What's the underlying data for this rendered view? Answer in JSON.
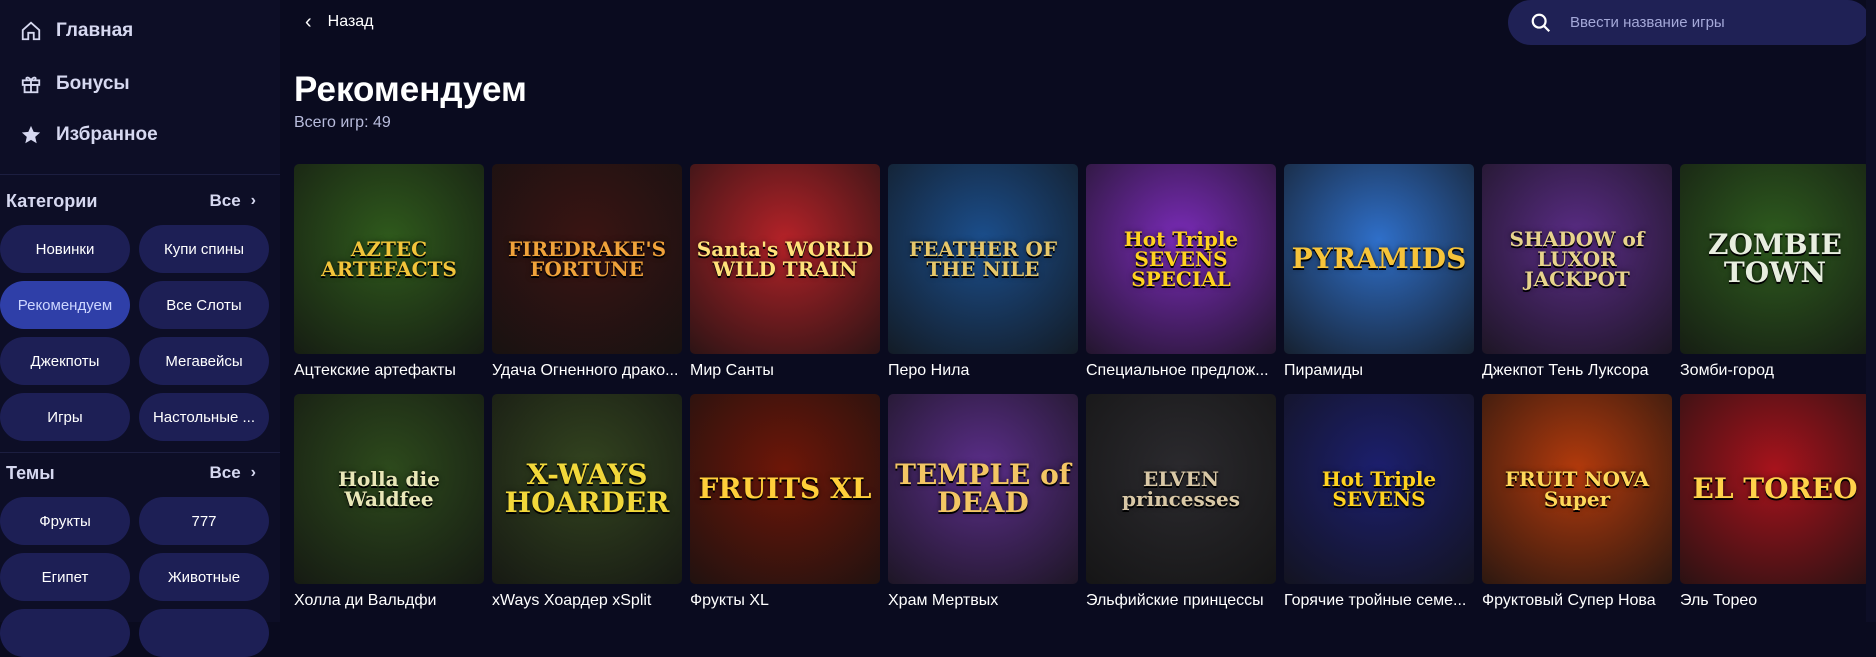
{
  "sidebar": {
    "nav": [
      {
        "label": "Главная",
        "icon": "home-icon"
      },
      {
        "label": "Бонусы",
        "icon": "gift-icon"
      },
      {
        "label": "Избранное",
        "icon": "star-icon"
      }
    ],
    "categories": {
      "title": "Категории",
      "all_label": "Все",
      "items": [
        "Новинки",
        "Купи спины",
        "Рекомендуем",
        "Все Слоты",
        "Джекпоты",
        "Мегавейсы",
        "Игры",
        "Настольные ..."
      ],
      "active": "Рекомендуем"
    },
    "themes": {
      "title": "Темы",
      "all_label": "Все",
      "items": [
        "Фрукты",
        "777",
        "Египет",
        "Животные"
      ]
    }
  },
  "topbar": {
    "back_label": "Назад",
    "search_placeholder": "Ввести название игры"
  },
  "main": {
    "title": "Рекомендуем",
    "count": "Всего игр: 49",
    "games": [
      {
        "name": "Ацтекские артефакты",
        "logo": "AZTEC ARTEFACTS",
        "bg": "#2f5a1c",
        "fg": "#f2c43a"
      },
      {
        "name": "Удача Огненного драко...",
        "logo": "FIREDRAKE'S FORTUNE",
        "bg": "#3a1412",
        "fg": "#f0a23a"
      },
      {
        "name": "Мир Санты",
        "logo": "Santa's WORLD WILD TRAIN",
        "bg": "#b42228",
        "fg": "#ffe27a"
      },
      {
        "name": "Перо Нила",
        "logo": "FEATHER OF THE NILE",
        "bg": "#1b4e8c",
        "fg": "#e6c76a"
      },
      {
        "name": "Специальное предлож...",
        "logo": "Hot Triple SEVENS SPECIAL",
        "bg": "#7a2bb8",
        "fg": "#ffd21f"
      },
      {
        "name": "Пирамиды",
        "logo": "PYRAMIDS",
        "bg": "#2f6fc9",
        "fg": "#f7c43a"
      },
      {
        "name": "Джекпот Тень Луксора",
        "logo": "SHADOW of LUXOR JACKPOT",
        "bg": "#5a2c86",
        "fg": "#e8d48c"
      },
      {
        "name": "Зомби-город",
        "logo": "ZOMBIE TOWN",
        "bg": "#2e5c1e",
        "fg": "#e8eee0"
      },
      {
        "name": "Холла ди Вальдфи",
        "logo": "Holla die Waldfee",
        "bg": "#2d4a1c",
        "fg": "#e9e7b8"
      },
      {
        "name": "xWays Хоардер xSplit",
        "logo": "X-WAYS HOARDER",
        "bg": "#33441f",
        "fg": "#f2d83a"
      },
      {
        "name": "Фрукты XL",
        "logo": "FRUITS XL",
        "bg": "#6e1608",
        "fg": "#ffcf3a"
      },
      {
        "name": "Храм Мертвых",
        "logo": "TEMPLE of DEAD",
        "bg": "#5b2e8a",
        "fg": "#f3c664"
      },
      {
        "name": "Эльфийские принцессы",
        "logo": "ELVEN princesses",
        "bg": "#2b2a2e",
        "fg": "#d9c8a6"
      },
      {
        "name": "Горячие тройные семе...",
        "logo": "Hot Triple SEVENS",
        "bg": "#1c1f6e",
        "fg": "#ffd21f"
      },
      {
        "name": "Фруктовый Супер Нова",
        "logo": "FRUIT NOVA Super",
        "bg": "#b33a0c",
        "fg": "#ffd95a"
      },
      {
        "name": "Эль Тореo",
        "logo": "EL TOREO",
        "bg": "#a8131c",
        "fg": "#ffd24a"
      }
    ]
  },
  "colors": {
    "background": "#0a0b1f",
    "sidebar": "#0d0e26",
    "pill": "#1d1f55",
    "pill_active": "#2f3fa8",
    "search": "#1f2155"
  }
}
